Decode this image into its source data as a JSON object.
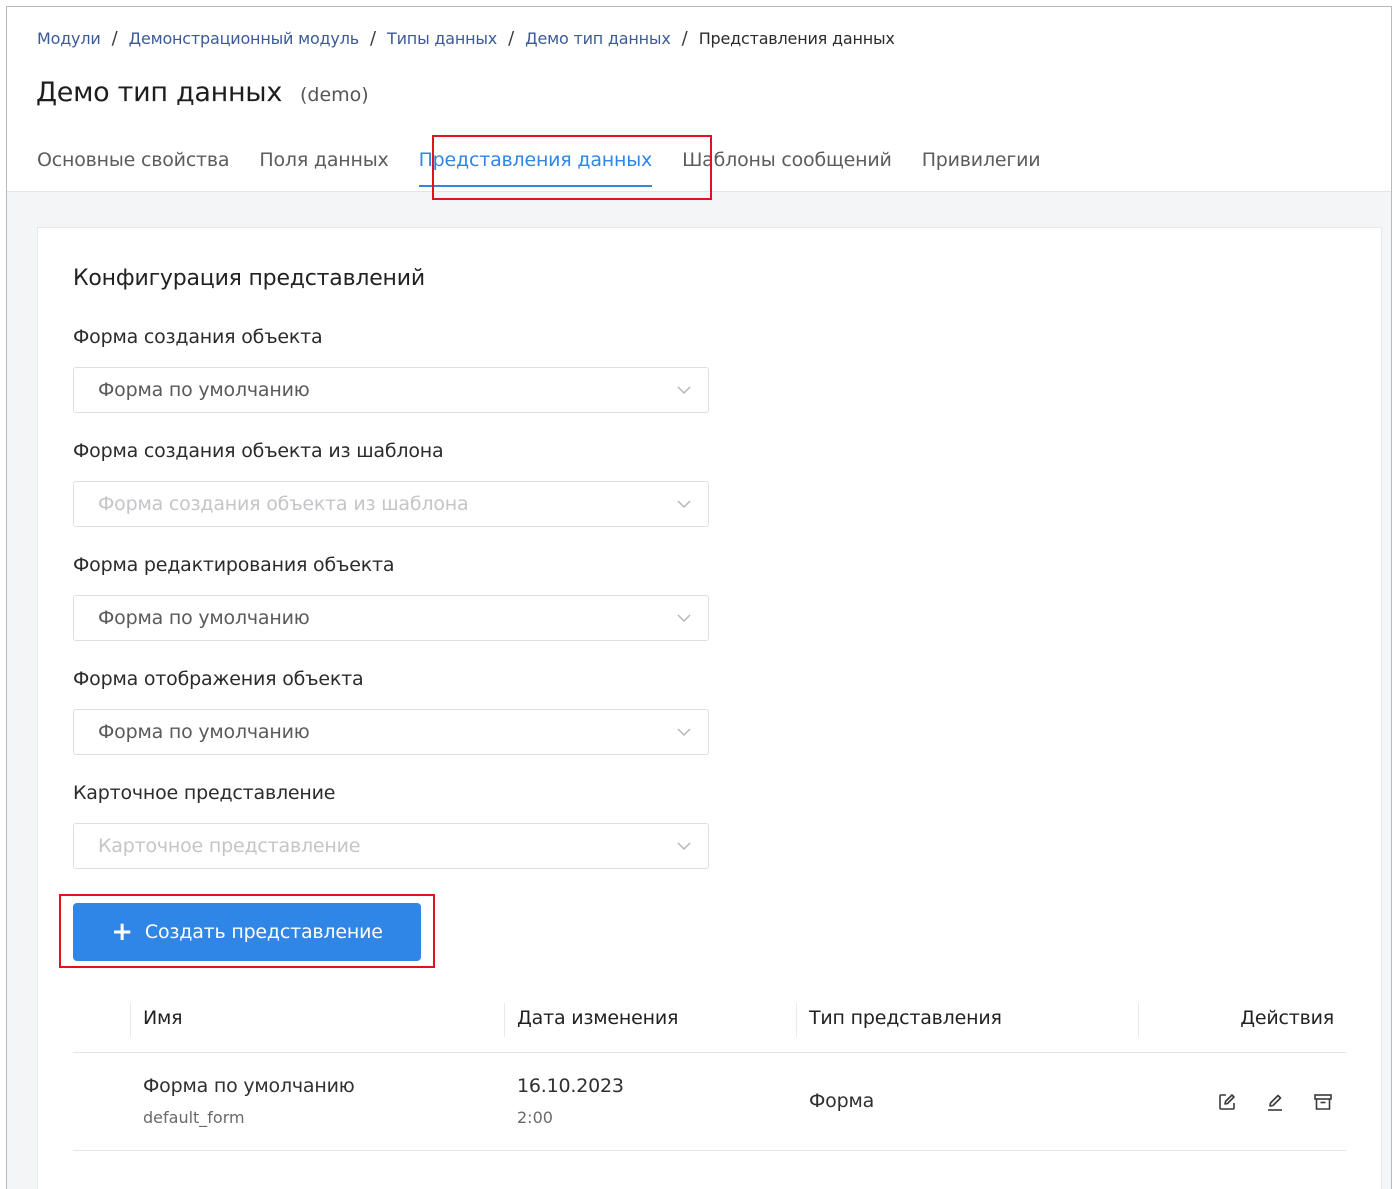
{
  "breadcrumb": {
    "items": [
      "Модули",
      "Демонстрационный модуль",
      "Типы данных",
      "Демо тип данных",
      "Представления данных"
    ],
    "separator": "/"
  },
  "header": {
    "title": "Демо тип данных",
    "code": "(demo)"
  },
  "tabs": [
    "Основные свойства",
    "Поля данных",
    "Представления данных",
    "Шаблоны сообщений",
    "Привилегии"
  ],
  "active_tab": "Представления данных",
  "config": {
    "title": "Конфигурация представлений",
    "fields": [
      {
        "label": "Форма создания объекта",
        "value": "Форма по умолчанию",
        "placeholder": ""
      },
      {
        "label": "Форма создания объекта из шаблона",
        "value": "",
        "placeholder": "Форма создания объекта из шаблона"
      },
      {
        "label": "Форма редактирования объекта",
        "value": "Форма по умолчанию",
        "placeholder": ""
      },
      {
        "label": "Форма отображения объекта",
        "value": "Форма по умолчанию",
        "placeholder": ""
      },
      {
        "label": "Карточное представление",
        "value": "",
        "placeholder": "Карточное представление"
      }
    ],
    "create_button": "Создать представление"
  },
  "table": {
    "columns": [
      "Имя",
      "Дата изменения",
      "Тип представления",
      "Действия"
    ],
    "rows": [
      {
        "name": "Форма по умолчанию",
        "code": "default_form",
        "date": "16.10.2023",
        "time": "2:00",
        "type": "Форма"
      }
    ]
  },
  "colors": {
    "accent": "#2f86e6",
    "highlight": "#e0121b"
  }
}
